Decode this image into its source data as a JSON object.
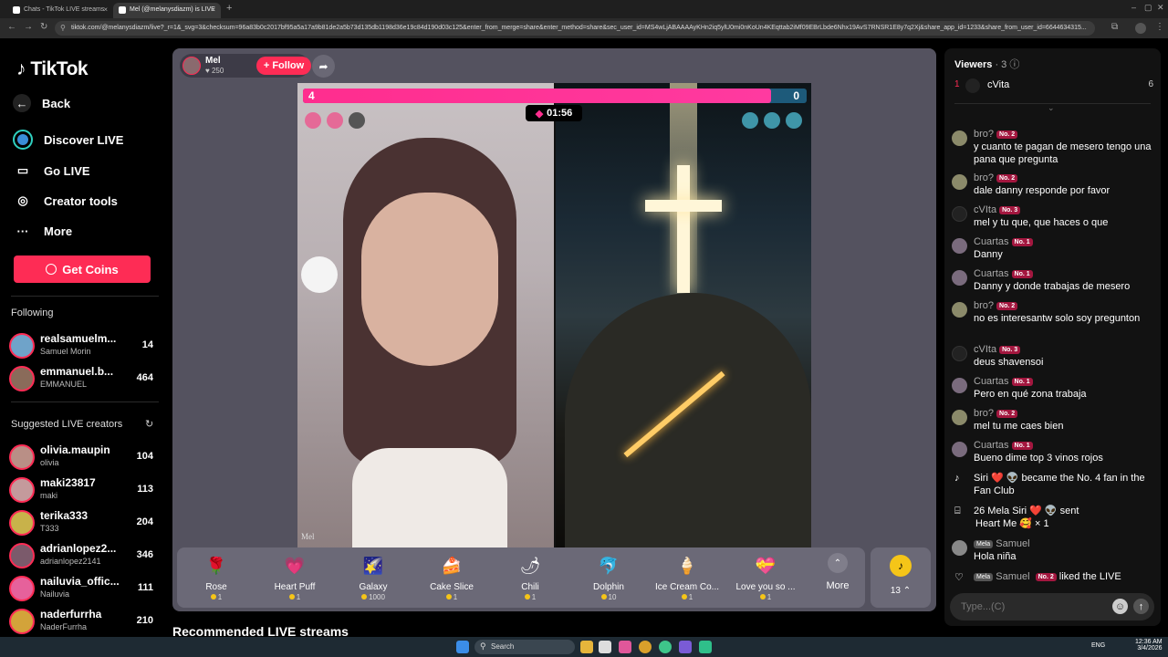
{
  "browser": {
    "tabs": [
      {
        "title": "Chats - TikTok LIVE streams",
        "close": "×"
      },
      {
        "title": "Mel (@melanysdiazm) is LIVE",
        "close": "×"
      }
    ],
    "new_tab": "+",
    "url": "tiktok.com/@melanysdiazm/live?_r=1&_svg=3&checksum=96a83b0c2017bf95a5a17a9b81de2a5b73d135db1198d36e19c84d190d03c125&enter_from_merge=share&enter_method=share&sec_user_id=MS4wLjABAAAAyKHn2iq5ylU0mi0nKoUn4KEqttab2iMf09EBrLbde6Nhx19AvS7RNSR1E8y7q2Xj&share_app_id=1233&share_from_user_id=6644634315..."
  },
  "sidebar": {
    "logo": "TikTok",
    "back": "Back",
    "nav": [
      {
        "label": "Discover LIVE",
        "icon": "live-avatar-icon"
      },
      {
        "label": "Go LIVE",
        "icon": "camera-icon"
      },
      {
        "label": "Creator tools",
        "icon": "lightbulb-icon"
      },
      {
        "label": "More",
        "icon": "more-dots-icon"
      }
    ],
    "get_coins": "Get Coins",
    "following_title": "Following",
    "following": [
      {
        "name": "realsamuelm...",
        "sub": "Samuel Morin",
        "count": "14",
        "color": "#6fa3c9"
      },
      {
        "name": "emmanuel.b...",
        "sub": "EMMANUEL",
        "count": "464",
        "color": "#8a6b5a"
      }
    ],
    "suggested_title": "Suggested LIVE creators",
    "suggested": [
      {
        "name": "olivia.maupin",
        "sub": "olivia",
        "count": "104",
        "color": "#b98f86"
      },
      {
        "name": "maki23817",
        "sub": "maki",
        "count": "113",
        "color": "#c49a9c"
      },
      {
        "name": "terika333",
        "sub": "T333",
        "count": "204",
        "color": "#c8b24a"
      },
      {
        "name": "adrianlopez2...",
        "sub": "adrianlopez2141",
        "count": "346",
        "color": "#7b5a6b"
      },
      {
        "name": "nailuvia_offic...",
        "sub": "Nailuvia",
        "count": "111",
        "color": "#e6619b"
      },
      {
        "name": "naderfurrha",
        "sub": "NaderFurrha",
        "count": "210",
        "color": "#d3a33a"
      }
    ]
  },
  "stream": {
    "host_name": "Mel",
    "host_likes": "250",
    "follow": "+ Follow",
    "score_left": "4",
    "score_right": "0",
    "score_fraction": 0.93,
    "timer": "01:56",
    "watermark": "Mel",
    "colors": {
      "accent": "#fe2c55",
      "pink": "#ff2d8e",
      "blue": "#1d5a7a"
    }
  },
  "gifts": [
    {
      "name": "Rose",
      "price": "1",
      "icon": "rose-icon",
      "glyph": "🌹"
    },
    {
      "name": "Heart Puff",
      "price": "1",
      "icon": "heart-puff-icon",
      "glyph": "💗"
    },
    {
      "name": "Galaxy",
      "price": "1000",
      "icon": "galaxy-icon",
      "glyph": "🌠"
    },
    {
      "name": "Cake Slice",
      "price": "1",
      "icon": "cake-icon",
      "glyph": "🍰"
    },
    {
      "name": "Chili",
      "price": "1",
      "icon": "chili-icon",
      "glyph": "🌶"
    },
    {
      "name": "Dolphin",
      "price": "10",
      "icon": "dolphin-icon",
      "glyph": "🐬"
    },
    {
      "name": "Ice Cream Co...",
      "price": "1",
      "icon": "ice-cream-icon",
      "glyph": "🍦"
    },
    {
      "name": "Love you so ...",
      "price": "1",
      "icon": "love-icon",
      "glyph": "💝"
    }
  ],
  "gift_more": "More",
  "coins_count": "13",
  "recommended": "Recommended LIVE streams",
  "viewers": {
    "title": "Viewers",
    "count": "· 3",
    "top": {
      "rank": "1",
      "name": "cVita",
      "score": "6"
    }
  },
  "chat": [
    {
      "user": "bro?",
      "badge": "No. 2",
      "msg": "y cuanto te pagan de mesero tengo una pana que pregunta",
      "color": "#8b8a6a"
    },
    {
      "user": "bro?",
      "badge": "No. 2",
      "msg": "dale danny responde por favor",
      "color": "#8b8a6a"
    },
    {
      "user": "cVIta",
      "badge": "No. 3",
      "msg": "mel y tu que, que haces o que",
      "color": "#222"
    },
    {
      "user": "Cuartas",
      "badge": "No. 1",
      "msg": "Danny",
      "color": "#7a6b7d"
    },
    {
      "user": "Cuartas",
      "badge": "No. 1",
      "msg": "Danny y donde trabajas de mesero",
      "color": "#7a6b7d"
    },
    {
      "user": "bro?",
      "badge": "No. 2",
      "msg": "no es interesantw solo soy pregunton",
      "color": "#8b8a6a"
    },
    {
      "user": "cVIta",
      "badge": "No. 3",
      "msg": "deus shavensoi",
      "color": "#222"
    },
    {
      "user": "Cuartas",
      "badge": "No. 1",
      "msg": "Pero en qué zona trabaja",
      "color": "#7a6b7d"
    },
    {
      "user": "bro?",
      "badge": "No. 2",
      "msg": "mel tu me caes bien",
      "color": "#8b8a6a"
    },
    {
      "user": "Cuartas",
      "badge": "No. 1",
      "msg": "Bueno dime top 3 vinos rojos",
      "color": "#7a6b7d"
    }
  ],
  "system": {
    "fanclub": "Siri ❤️ 👽 became the No. 4 fan in the Fan Club",
    "gift_line1": "26  Mela  Siri ❤️ 👽 sent",
    "gift_line2": "Heart Me 🥰 × 1",
    "samuel_badge": "Mela",
    "samuel_name": "Samuel",
    "samuel_msg": "Hola niña",
    "liked_badge1": "Mela",
    "liked_name": "Samuel",
    "liked_badge2": "No. 2",
    "liked_msg": "liked the LIVE"
  },
  "input_placeholder": "Type...(C)",
  "taskbar": {
    "search": "Search",
    "lang": "ENG",
    "time": "12:36 AM",
    "date": "3/4/2026"
  }
}
